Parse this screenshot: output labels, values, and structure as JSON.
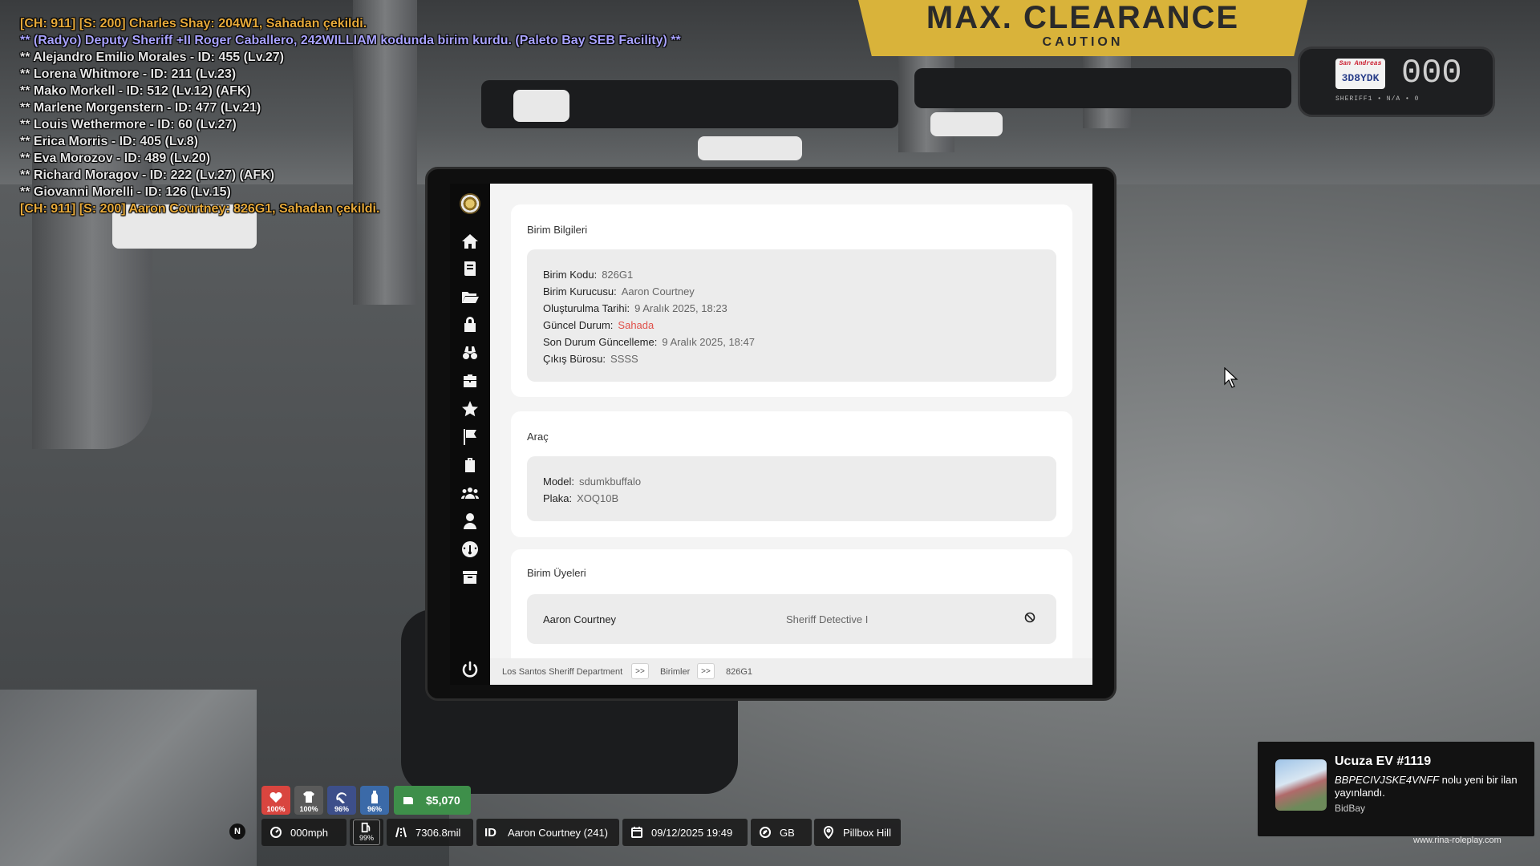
{
  "chat": [
    {
      "text": "[CH: 911] [S: 200] Charles Shay: 204W1, Sahadan çekildi.",
      "color": "orange"
    },
    {
      "text": "** (Radyo) Deputy Sheriff +II Roger Caballero, 242WILLIAM kodunda birim kurdu. (Paleto Bay SEB Facility) **",
      "color": "purple"
    },
    {
      "text": "** Alejandro Emilio Morales - ID: 455 (Lv.27)",
      "color": "white"
    },
    {
      "text": "** Lorena Whitmore - ID: 211 (Lv.23)",
      "color": "white"
    },
    {
      "text": "** Mako Morkell - ID: 512 (Lv.12) (AFK)",
      "color": "white"
    },
    {
      "text": "** Marlene Morgenstern - ID: 477 (Lv.21)",
      "color": "white"
    },
    {
      "text": "** Louis Wethermore - ID: 60 (Lv.27)",
      "color": "white"
    },
    {
      "text": "** Erica Morris - ID: 405 (Lv.8)",
      "color": "white"
    },
    {
      "text": "** Eva Morozov - ID: 489 (Lv.20)",
      "color": "white"
    },
    {
      "text": "** Richard Moragov - ID: 222 (Lv.27) (AFK)",
      "color": "white"
    },
    {
      "text": "** Giovanni Morelli - ID: 126 (Lv.15)",
      "color": "white"
    },
    {
      "text": "[CH: 911] [S: 200] Aaron Courtney: 826G1, Sahadan çekildi.",
      "color": "orange"
    }
  ],
  "scene": {
    "sign_big": "MAX. CLEARANCE",
    "sign_small": "CAUTION"
  },
  "dashcam": {
    "plate_state": "San Andreas",
    "plate": "3D8YDK",
    "speed": "000",
    "sub": "SHERIFF1 • N/A • 0"
  },
  "tablet": {
    "unit_info": {
      "title": "Birim Bilgileri",
      "rows": [
        {
          "label": "Birim Kodu:",
          "value": "826G1"
        },
        {
          "label": "Birim Kurucusu:",
          "value": "Aaron Courtney"
        },
        {
          "label": "Oluşturulma Tarihi:",
          "value": "9 Aralık 2025, 18:23"
        },
        {
          "label": "Güncel Durum:",
          "value": "Sahada"
        },
        {
          "label": "Son Durum Güncelleme:",
          "value": "9 Aralık 2025, 18:47"
        },
        {
          "label": "Çıkış Bürosu:",
          "value": "SSSS"
        }
      ]
    },
    "vehicle": {
      "title": "Araç",
      "rows": [
        {
          "label": "Model:",
          "value": "sdumkbuffalo"
        },
        {
          "label": "Plaka:",
          "value": "XOQ10B"
        }
      ]
    },
    "members": {
      "title": "Birim Üyeleri",
      "items": [
        {
          "name": "Aaron Courtney",
          "rank": "Sheriff Detective I"
        }
      ]
    },
    "breadcrumb": [
      "Los Santos Sheriff Department",
      "Birimler",
      "826G1"
    ],
    "breadcrumb_sep": ">>"
  },
  "hud": {
    "stats": [
      {
        "name": "health",
        "value": "100%",
        "color": "#d9453f"
      },
      {
        "name": "armor",
        "value": "100%",
        "color": "#5a5a5a"
      },
      {
        "name": "hunger",
        "value": "96%",
        "color": "#3d4f8a"
      },
      {
        "name": "thirst",
        "value": "96%",
        "color": "#3b6aa8"
      }
    ],
    "money": "$5,070",
    "speed": "000mph",
    "fuel": "99%",
    "distance": "7306.8mil",
    "id_label": "ID",
    "player": "Aaron Courtney (241)",
    "datetime": "09/12/2025 19:49",
    "heading": "GB",
    "location": "Pillbox Hill",
    "north": "N"
  },
  "notification": {
    "title": "Ucuza EV #1119",
    "code": "BBPECIVJSKE4VNFF",
    "body": " nolu yeni bir ilan yayınlandı.",
    "source": "BidBay"
  },
  "watermark": "www.rina-roleplay.com"
}
